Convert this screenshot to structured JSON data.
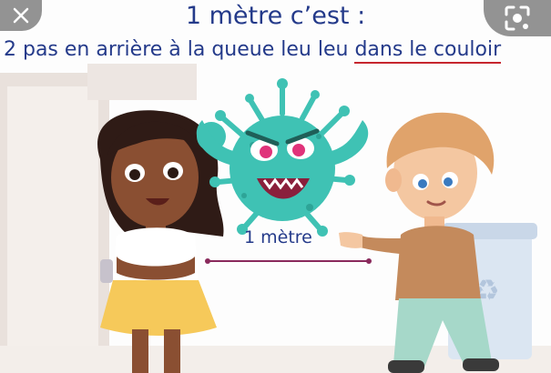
{
  "poster": {
    "title": "1 mètre c’est :",
    "subtitle_start": "2 pas en arrière à la queue leu leu",
    "subtitle_underlined": "dans le couloir",
    "distance_label": "1 mètre"
  },
  "overlay": {
    "close_icon": "close-icon",
    "lens_icon": "visual-search-icon"
  },
  "colors": {
    "text": "#243a8a",
    "underline": "#c6262e",
    "virus": "#3fc2b4",
    "distance_line": "#8a2a5c"
  }
}
